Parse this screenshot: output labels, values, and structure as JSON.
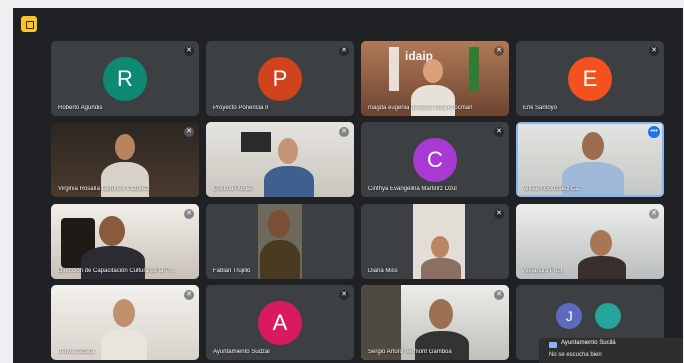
{
  "participants": [
    {
      "name": "Roberto Agundis",
      "initial": "R",
      "color": "#0e8a74"
    },
    {
      "name": "Proyecto Ponencia II",
      "initial": "P",
      "color": "#d1431d"
    },
    {
      "name": "magda eugenia de jesus lozano ocman"
    },
    {
      "name": "Erik Santoyo",
      "initial": "E",
      "color": "#f4511e"
    },
    {
      "name": "Virginia Rosalía Lagunes Vázquez"
    },
    {
      "name": "Cristina Pulgar"
    },
    {
      "name": "Cinthya Evangelina Martinrz Dzul",
      "initial": "C",
      "color": "#a83ad3"
    },
    {
      "name": "William González Ca..."
    },
    {
      "name": "Dirección de Capacitación Cultura de la Tr..."
    },
    {
      "name": "Fabian Trujillo"
    },
    {
      "name": "Diana Miss"
    },
    {
      "name": "Alejandra Poot"
    },
    {
      "name": "Itenya zapata"
    },
    {
      "name": "Ayuntamiento Sudzal",
      "initial": "A",
      "color": "#d81b60"
    },
    {
      "name": "Sergio Arturo Vermont Gamboa"
    },
    {
      "name": "",
      "initial": "J",
      "color": "#5c6bc0"
    }
  ],
  "video_signage": {
    "backdrop_text": "idaip"
  },
  "chat_notification": {
    "sender": "Ayuntamiento Sucilá",
    "message": "No se escucha bien"
  }
}
